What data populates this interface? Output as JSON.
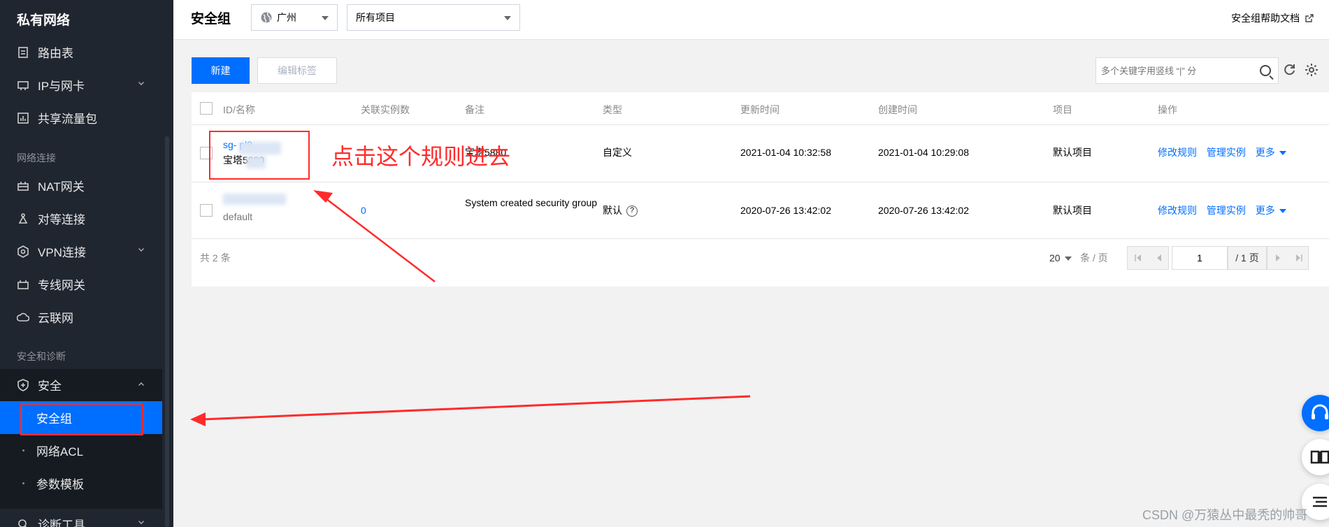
{
  "sidebar": {
    "title": "私有网络",
    "items_top": [
      {
        "label": "路由表"
      },
      {
        "label": "IP与网卡"
      },
      {
        "label": "共享流量包"
      }
    ],
    "section_network": "网络连接",
    "items_network": [
      {
        "label": "NAT网关"
      },
      {
        "label": "对等连接"
      },
      {
        "label": "VPN连接"
      },
      {
        "label": "专线网关"
      },
      {
        "label": "云联网"
      }
    ],
    "section_security": "安全和诊断",
    "security_group_label": "安全",
    "security_sub": [
      {
        "label": "安全组",
        "active": true
      },
      {
        "label": "网络ACL"
      },
      {
        "label": "参数模板"
      }
    ],
    "diag_label": "诊断工具"
  },
  "header": {
    "title": "安全组",
    "region": "广州",
    "project": "所有项目",
    "help_link": "安全组帮助文档"
  },
  "toolbar": {
    "new_label": "新建",
    "edit_tags_label": "编辑标签",
    "search_placeholder": "多个关键字用竖线 “|” 分"
  },
  "table": {
    "columns": [
      "ID/名称",
      "关联实例数",
      "备注",
      "类型",
      "更新时间",
      "创建时间",
      "项目",
      "操作"
    ],
    "rows": [
      {
        "id": "sg-        pl9",
        "name": "宝塔5880",
        "instances": "",
        "remark": "宝塔5880",
        "type": "自定义",
        "updated": "2021-01-04 10:32:58",
        "created": "2021-01-04 10:29:08",
        "project": "默认项目",
        "actions": [
          "修改规则",
          "管理实例",
          "更多"
        ]
      },
      {
        "id": "",
        "name": "default",
        "instances": "0",
        "remark": "System created security group",
        "type": "默认",
        "updated": "2020-07-26 13:42:02",
        "created": "2020-07-26 13:42:02",
        "project": "默认项目",
        "actions": [
          "修改规则",
          "管理实例",
          "更多"
        ]
      }
    ],
    "total": "共 2 条",
    "page_size": "20",
    "per_page": "条 / 页",
    "page": "1",
    "page_total": "/ 1 页"
  },
  "annotation": {
    "text": "点击这个规则进去",
    "color": "#ff2b2b"
  },
  "watermark": "CSDN @万猿丛中最秃的帅哥",
  "colors": {
    "accent": "#006eff",
    "sidebar": "#202630"
  }
}
